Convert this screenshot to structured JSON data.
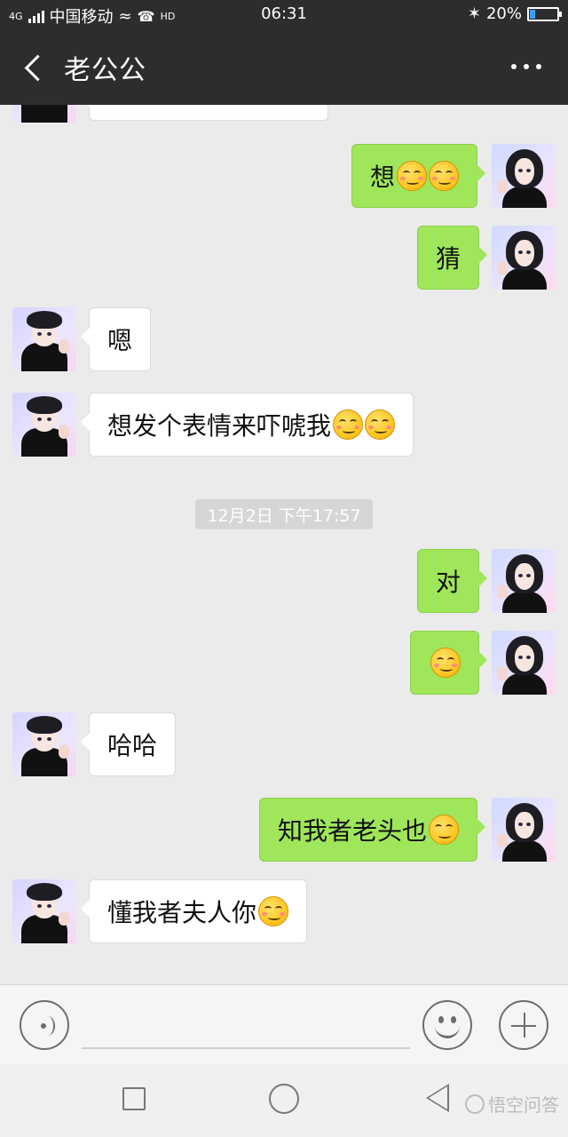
{
  "status_bar": {
    "network": "4G",
    "carrier": "中国移动",
    "hd": "HD",
    "time": "06:31",
    "battery": "20%",
    "battery_level": 0.2
  },
  "header": {
    "title": "老公公"
  },
  "timestamp": "12月2日 下午17:57",
  "messages": [
    {
      "side": "out",
      "text": "想",
      "emoji_count": 2
    },
    {
      "side": "out",
      "text": "猜",
      "emoji_count": 0
    },
    {
      "side": "in",
      "text": "嗯",
      "emoji_count": 0
    },
    {
      "side": "in",
      "text": "想发个表情来吓唬我",
      "emoji_count": 2
    },
    {
      "side": "out",
      "text": "对",
      "emoji_count": 0
    },
    {
      "side": "out",
      "text": "",
      "emoji_count": 1
    },
    {
      "side": "in",
      "text": "哈哈",
      "emoji_count": 0
    },
    {
      "side": "out",
      "text": "知我者老头也",
      "emoji_count": 1
    },
    {
      "side": "in",
      "text": "懂我者夫人你",
      "emoji_count": 1
    }
  ],
  "icons": {
    "back": "chevron-left-icon",
    "more": "more-dots-icon",
    "voice": "voice-icon",
    "emoji": "emoji-icon",
    "plus": "plus-icon"
  },
  "colors": {
    "header_bg": "#2d2d2d",
    "outgoing_bubble": "#9fe65a",
    "incoming_bubble": "#ffffff",
    "chat_bg": "#ebebeb"
  },
  "watermark": "悟空问答"
}
